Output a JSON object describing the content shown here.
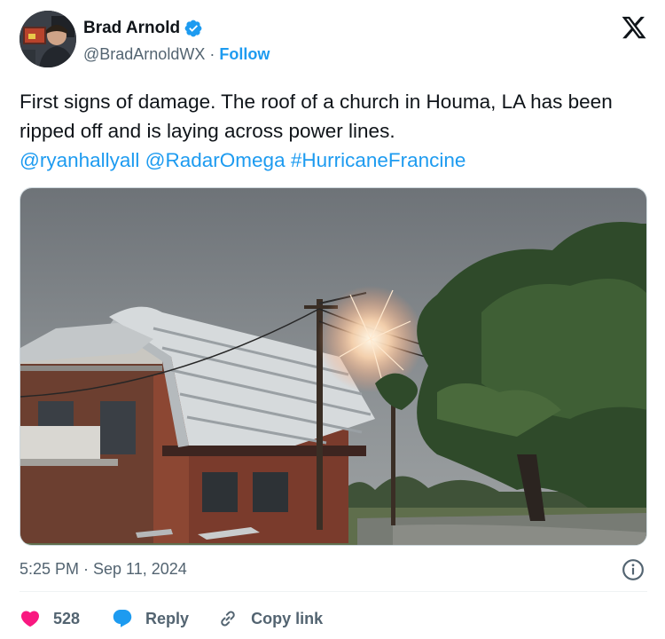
{
  "author": {
    "display_name": "Brad Arnold",
    "handle": "@BradArnoldWX",
    "separator": "·",
    "follow_label": "Follow",
    "verified": true
  },
  "tweet": {
    "text_plain": "First signs of damage. The roof of a church in Houma, LA has been ripped off and is laying across power lines.",
    "mentions": [
      "@ryanhallyall",
      "@RadarOmega"
    ],
    "hashtag": "#HurricaneFrancine",
    "timestamp": "5:25 PM · Sep 11, 2024"
  },
  "actions": {
    "like_count": "528",
    "reply_label": "Reply",
    "copy_label": "Copy link"
  },
  "icons": [
    "verified-badge-icon",
    "x-logo-icon",
    "info-icon",
    "heart-icon",
    "reply-bubble-icon",
    "link-icon"
  ],
  "colors": {
    "accent": "#1d9bf0",
    "text": "#0f1419",
    "muted": "#536471",
    "like": "#f91880"
  }
}
